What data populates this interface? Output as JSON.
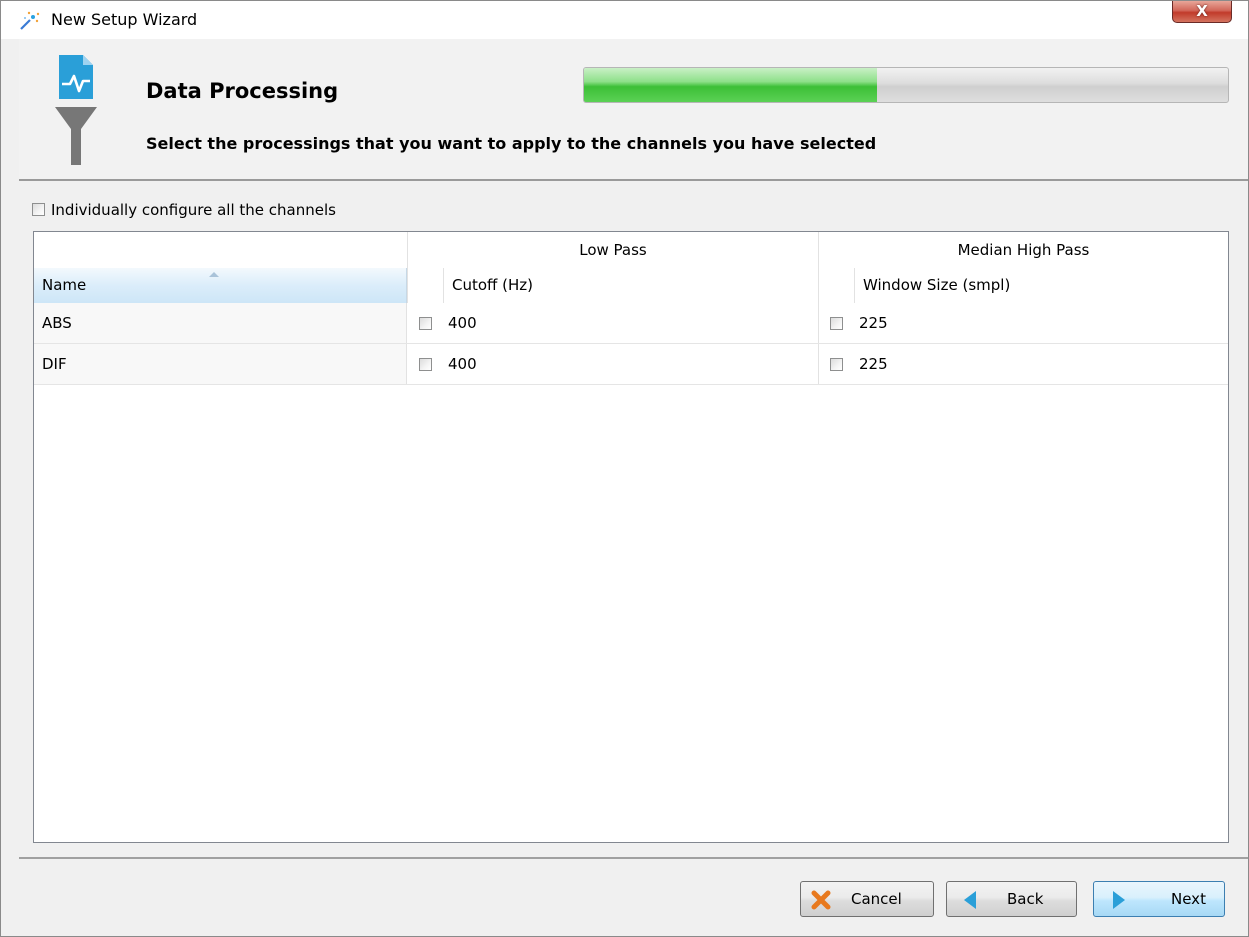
{
  "window": {
    "title": "New Setup Wizard",
    "close_label": "X"
  },
  "header": {
    "title": "Data Processing",
    "subtitle": "Select the processings that you want to apply to the channels you have selected",
    "progress_fraction": 0.455,
    "progress_color": "#3cbf37",
    "icon": "funnel-filter-icon"
  },
  "options": {
    "individually_configure_label": "Individually configure all the channels",
    "individually_configure_checked": false
  },
  "table": {
    "group_headers": [
      "Low Pass",
      "Median High Pass"
    ],
    "columns": [
      "Name",
      "Cutoff (Hz)",
      "Window Size (smpl)"
    ],
    "rows": [
      {
        "name": "ABS",
        "low_pass_enabled": false,
        "cutoff": "400",
        "median_enabled": false,
        "window_size": "225"
      },
      {
        "name": "DIF",
        "low_pass_enabled": false,
        "cutoff": "400",
        "median_enabled": false,
        "window_size": "225"
      }
    ]
  },
  "footer": {
    "cancel_label": "Cancel",
    "back_label": "Back",
    "next_label": "Next"
  },
  "colors": {
    "accent_blue": "#2a9fd8",
    "cancel_orange": "#e8791e"
  }
}
